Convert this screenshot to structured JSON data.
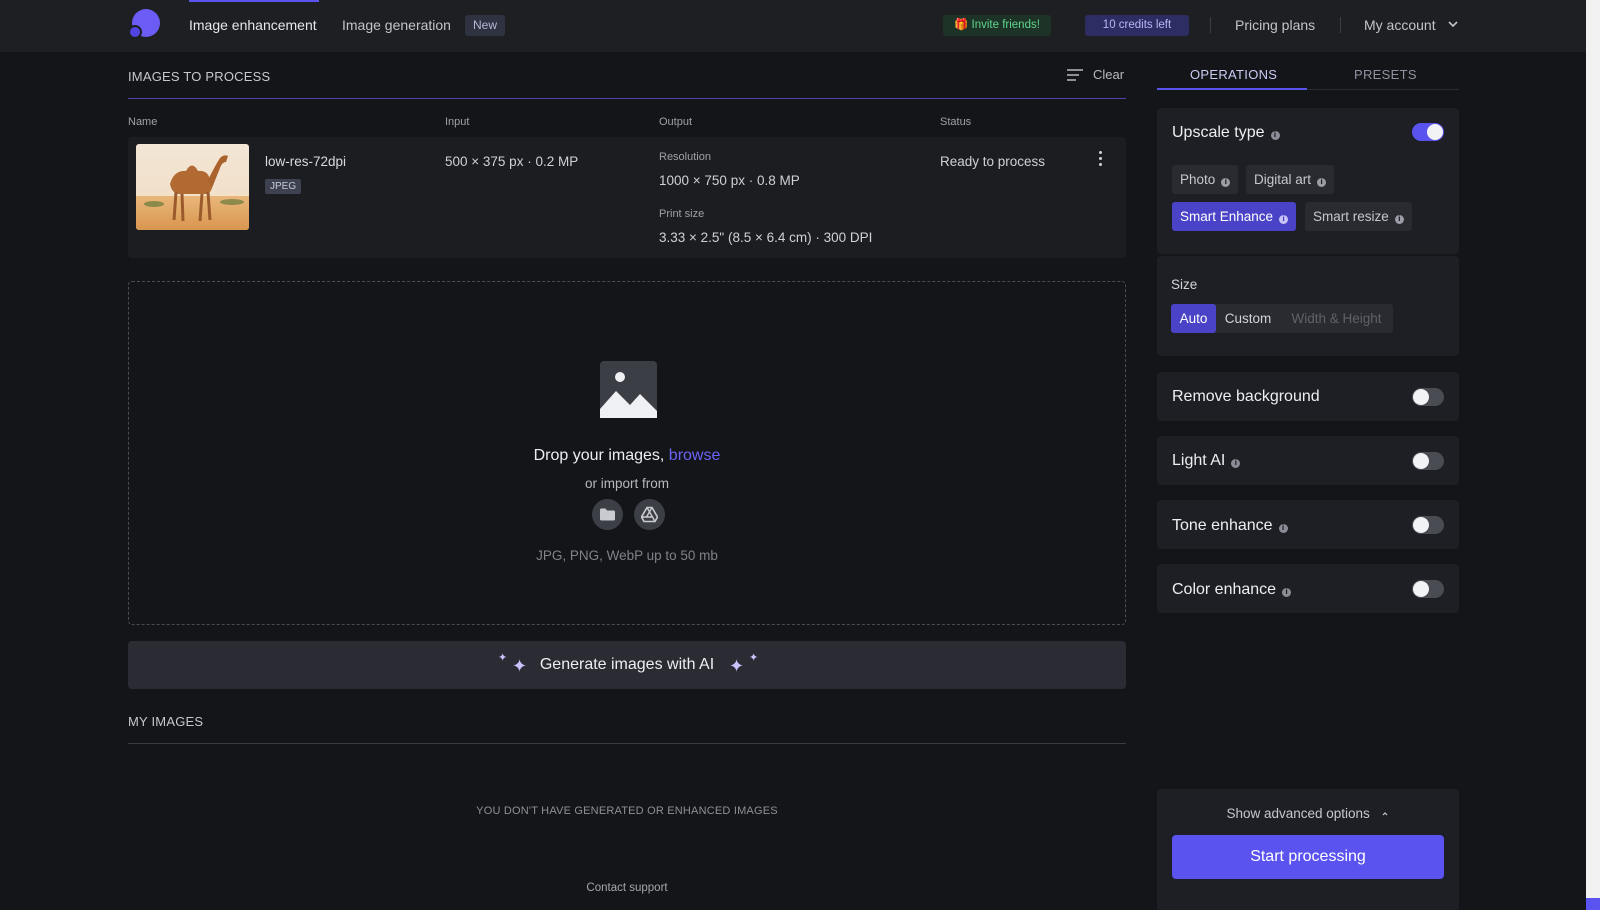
{
  "nav": {
    "items": [
      {
        "label": "Image enhancement"
      },
      {
        "label": "Image generation"
      }
    ],
    "new_badge": "New",
    "invite": "🎁 Invite friends!",
    "credits": "10 credits left",
    "pricing": "Pricing plans",
    "account": "My account"
  },
  "queue": {
    "title": "IMAGES TO PROCESS",
    "clear": "Clear",
    "columns": [
      "Name",
      "Input",
      "Output",
      "Status"
    ],
    "rows": [
      {
        "name": "low-res-72dpi",
        "format": "JPEG",
        "input": "500 × 375 px · 0.2 MP",
        "resolution_label": "Resolution",
        "resolution": "1000 × 750 px · 0.8 MP",
        "print_label": "Print size",
        "print": "3.33 × 2.5\" (8.5 × 6.4 cm) · 300 DPI",
        "status": "Ready to process"
      }
    ]
  },
  "dropzone": {
    "prompt": "Drop your images,",
    "browse": "browse",
    "import": "or import from",
    "formats": "JPG, PNG, WebP up to 50 mb"
  },
  "generate": {
    "label": "Generate images with AI"
  },
  "my_images": {
    "title": "MY IMAGES",
    "empty": "YOU DON'T HAVE GENERATED OR ENHANCED IMAGES",
    "support": "Contact support"
  },
  "panel": {
    "tabs": [
      "OPERATIONS",
      "PRESETS"
    ],
    "upscale": {
      "title": "Upscale type",
      "enabled": true,
      "options": [
        "Photo",
        "Digital art",
        "Smart Enhance",
        "Smart resize"
      ],
      "selected": "Smart Enhance"
    },
    "size": {
      "label": "Size",
      "options": [
        "Auto",
        "Custom",
        "Width & Height"
      ],
      "selected": "Auto"
    },
    "toggles": [
      {
        "label": "Remove background",
        "info": false,
        "on": false
      },
      {
        "label": "Light AI",
        "info": true,
        "on": false
      },
      {
        "label": "Tone enhance",
        "info": true,
        "on": false
      },
      {
        "label": "Color enhance",
        "info": true,
        "on": false
      }
    ],
    "advanced": "Show advanced options",
    "start": "Start processing"
  },
  "colors": {
    "accent": "#5b53f0",
    "background": "#141518",
    "panel": "#1e1f24",
    "invite_text": "#5fd58c"
  }
}
